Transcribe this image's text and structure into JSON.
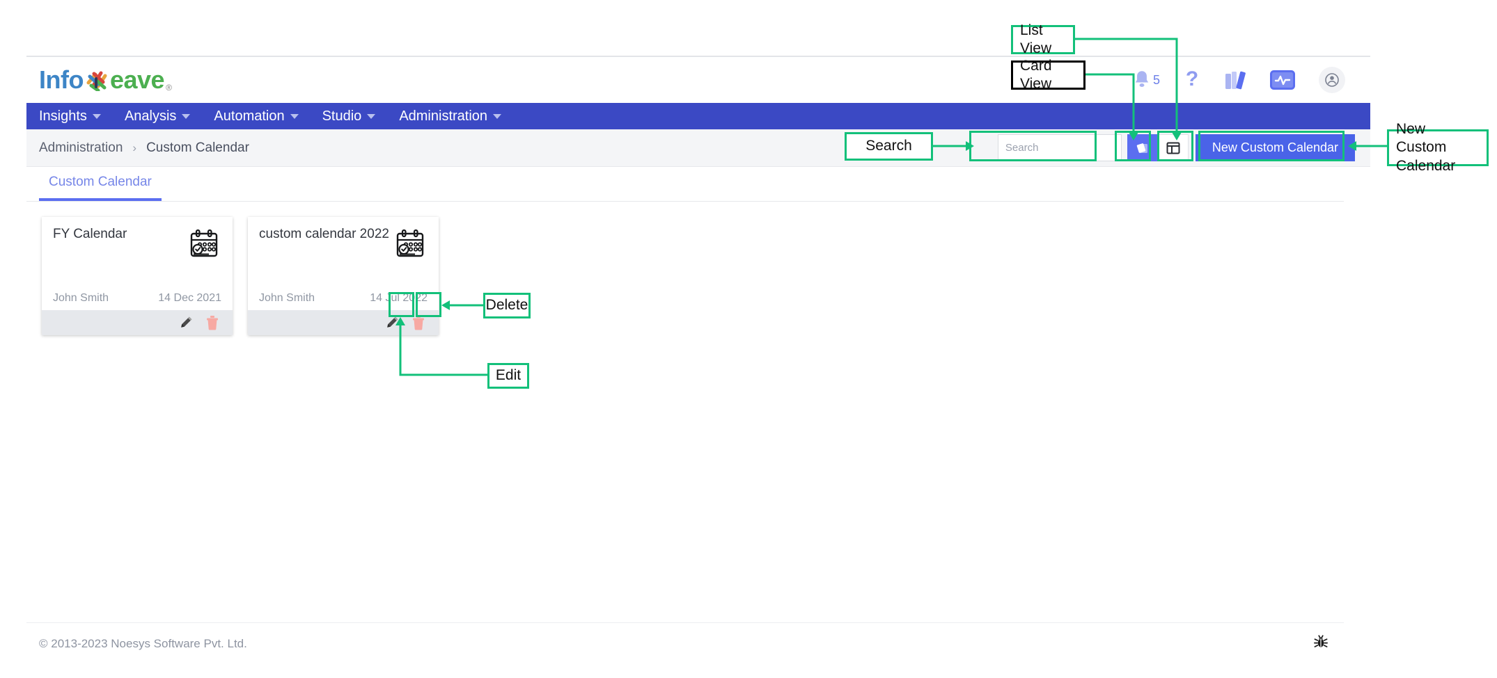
{
  "app": {
    "logo_info": "Info",
    "logo_eave": "eave",
    "logo_reg": "®"
  },
  "header_icons": [
    {
      "name": "notifications-bell-icon",
      "badge": "5"
    },
    {
      "name": "help-question-icon",
      "badge": ""
    },
    {
      "name": "library-books-icon",
      "badge": ""
    },
    {
      "name": "monitor-activity-icon",
      "badge": ""
    },
    {
      "name": "user-account-icon",
      "badge": ""
    }
  ],
  "nav": {
    "items": [
      {
        "label": "Insights",
        "has_caret": true
      },
      {
        "label": "Analysis",
        "has_caret": true
      },
      {
        "label": "Automation",
        "has_caret": true
      },
      {
        "label": "Studio",
        "has_caret": true
      },
      {
        "label": "Administration",
        "has_caret": true
      }
    ]
  },
  "breadcrumb": {
    "parent": "Administration",
    "separator": "›",
    "current": "Custom Calendar"
  },
  "toolbar": {
    "search_placeholder": "Search",
    "search_value": "",
    "new_button_label": "New Custom Calendar",
    "card_view_active": true,
    "list_view_active": false
  },
  "tabs": [
    {
      "label": "Custom Calendar",
      "active": true
    }
  ],
  "cards": [
    {
      "title": "FY Calendar",
      "owner": "John Smith",
      "date": "14 Dec 2021",
      "edit_label": "edit",
      "delete_label": "delete"
    },
    {
      "title": "custom calendar 2022",
      "owner": "John Smith",
      "date": "14 Jul 2022",
      "edit_label": "edit",
      "delete_label": "delete"
    }
  ],
  "footer": {
    "copyright": "© 2013-2023 Noesys Software Pvt. Ltd.",
    "bug_icon": "bug-icon"
  },
  "annotations": [
    {
      "id": "list-view",
      "text": "List View",
      "border": "green"
    },
    {
      "id": "card-view",
      "text": "Card View",
      "border": "black"
    },
    {
      "id": "search",
      "text": "Search",
      "border": "green"
    },
    {
      "id": "new-custom",
      "text": "New Custom\nCalendar",
      "border": "green"
    },
    {
      "id": "delete",
      "text": "Delete",
      "border": "green"
    },
    {
      "id": "edit",
      "text": "Edit",
      "border": "green"
    }
  ],
  "colors": {
    "nav_blue": "#3b49c4",
    "primary_blue": "#4a63e8",
    "accent_green": "#13c07a",
    "toolbar_grey": "#f4f5f7",
    "card_action_grey": "#e6e8ec"
  }
}
